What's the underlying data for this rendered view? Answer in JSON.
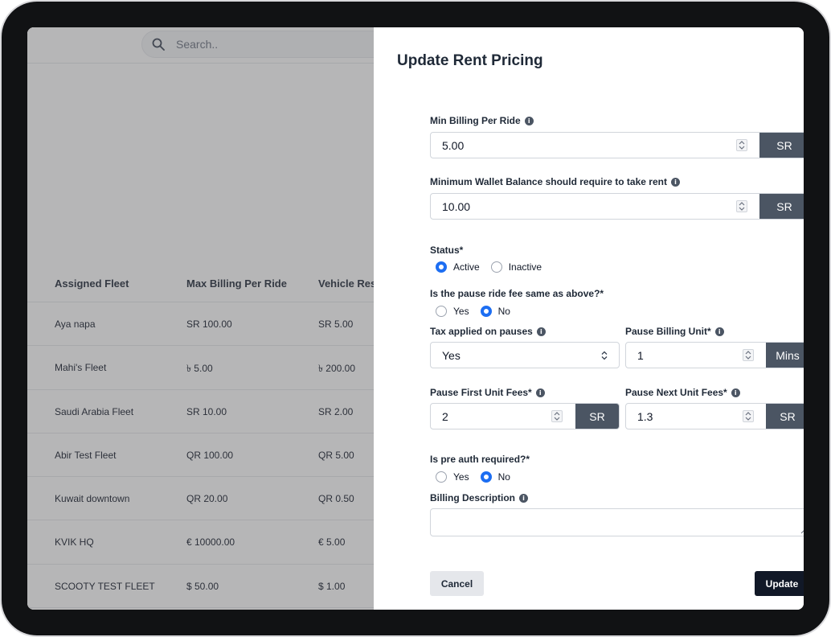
{
  "search": {
    "placeholder": "Search.."
  },
  "table": {
    "headers": [
      "Assigned Fleet",
      "Max Billing Per Ride",
      "Vehicle Res"
    ],
    "rows": [
      [
        "Aya napa",
        "SR 100.00",
        "SR 5.00"
      ],
      [
        "Mahi's Fleet",
        "৳ 5.00",
        "৳ 200.00"
      ],
      [
        "Saudi Arabia Fleet",
        "SR 10.00",
        "SR 2.00"
      ],
      [
        "Abir Test Fleet",
        "QR 100.00",
        "QR 5.00"
      ],
      [
        "Kuwait downtown",
        "QR 20.00",
        "QR 0.50"
      ],
      [
        "KVIK HQ",
        "€ 10000.00",
        "€ 5.00"
      ],
      [
        "SCOOTY TEST FLEET",
        "$ 50.00",
        "$ 1.00"
      ]
    ]
  },
  "drawer": {
    "title": "Update Rent Pricing",
    "min_billing": {
      "label": "Min Billing Per Ride",
      "value": "5.00",
      "unit": "SR"
    },
    "min_wallet": {
      "label": "Minimum Wallet Balance should require to take rent",
      "value": "10.00",
      "unit": "SR"
    },
    "status": {
      "label": "Status*",
      "options": [
        "Active",
        "Inactive"
      ],
      "selected": "Active"
    },
    "pause_same": {
      "label": "Is the pause ride fee same as above?*",
      "options": [
        "Yes",
        "No"
      ],
      "selected": "No"
    },
    "tax_on_pauses": {
      "label": "Tax applied on pauses",
      "value": "Yes"
    },
    "pause_billing_unit": {
      "label": "Pause Billing Unit*",
      "value": "1",
      "unit": "Mins"
    },
    "pause_first_fee": {
      "label": "Pause First Unit Fees*",
      "value": "2",
      "unit": "SR"
    },
    "pause_next_fee": {
      "label": "Pause Next Unit Fees*",
      "value": "1.3",
      "unit": "SR"
    },
    "pre_auth": {
      "label": "Is pre auth required?*",
      "options": [
        "Yes",
        "No"
      ],
      "selected": "No"
    },
    "billing_description": {
      "label": "Billing Description",
      "value": ""
    },
    "cancel_label": "Cancel",
    "update_label": "Update"
  },
  "colors": {
    "accent": "#1d6ef2",
    "addon": "#4b5563",
    "primary_button": "#111827"
  }
}
